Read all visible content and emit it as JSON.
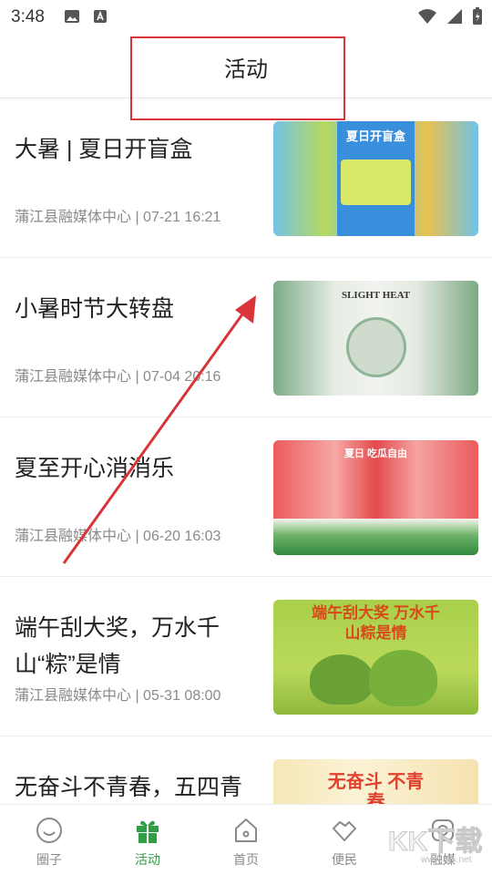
{
  "status": {
    "time": "3:48"
  },
  "header": {
    "title": "活动"
  },
  "items": [
    {
      "title": "大暑 | 夏日开盲盒",
      "meta": "蒲江县融媒体中心 | 07-21 16:21",
      "thumb_text": "夏日开盲盒"
    },
    {
      "title": "小暑时节大转盘",
      "meta": "蒲江县融媒体中心 | 07-04 20:16",
      "thumb_text": "SLIGHT HEAT"
    },
    {
      "title": "夏至开心消消乐",
      "meta": "蒲江县融媒体中心 | 06-20 16:03",
      "thumb_text": "夏日 吃瓜自由"
    },
    {
      "title": "端午刮大奖，万水千山“粽”是情",
      "meta": "蒲江县融媒体中心 | 05-31 08:00",
      "thumb_text": "端午刮大奖 万水千山粽是情"
    },
    {
      "title": "无奋斗不青春，五四青",
      "meta": "",
      "thumb_text": "无奋斗 不青春"
    }
  ],
  "tabbar": {
    "tabs": [
      {
        "label": "圈子",
        "icon": "smile-icon"
      },
      {
        "label": "活动",
        "icon": "gift-icon"
      },
      {
        "label": "首页",
        "icon": "home-icon"
      },
      {
        "label": "便民",
        "icon": "handshake-icon"
      },
      {
        "label": "融媒",
        "icon": "media-icon"
      }
    ],
    "active_color": "#2f9e44",
    "inactive_color": "#8a8a8a"
  },
  "watermark": {
    "text": "KK下载 www.kkx.net"
  },
  "colors": {
    "highlight": "#d9343a",
    "arrow": "#d9343a"
  }
}
